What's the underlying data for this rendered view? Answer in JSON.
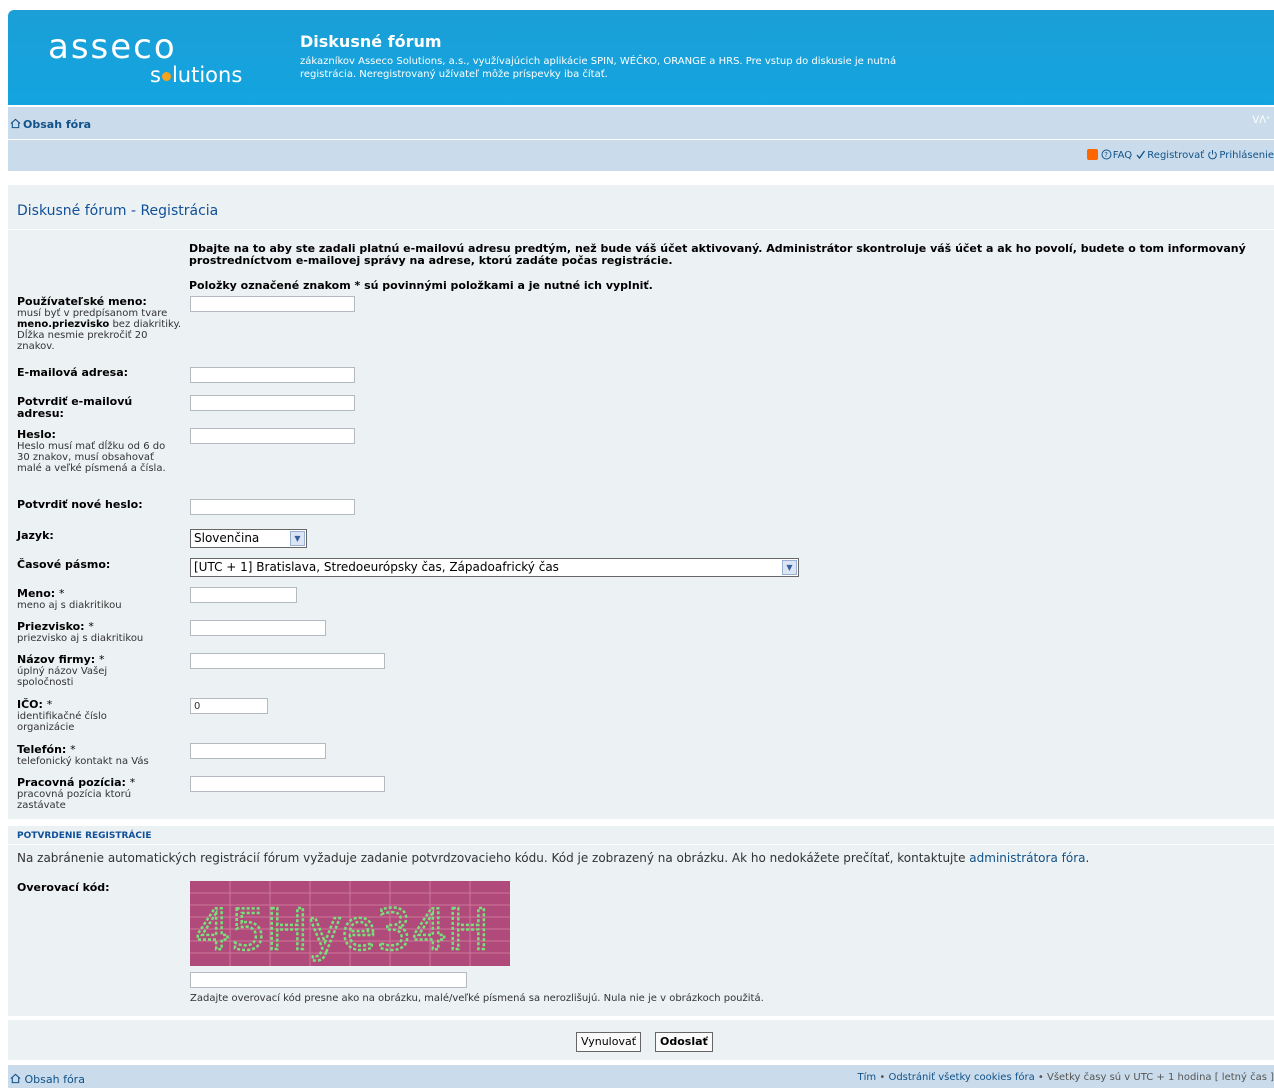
{
  "logo": {
    "big": "asseco",
    "small_before": "s",
    "small_after": "lutions"
  },
  "site": {
    "title": "Diskusné fórum",
    "desc": "zákazníkov Asseco Solutions, a.s., využívajúcich aplikácie SPIN, WÉČKO, ORANGE a HRS. Pre vstup do diskusie je nutná registrácia. Neregistrovaný užívateľ môže príspevky iba čítať."
  },
  "nav": {
    "crumb": "Obsah fóra",
    "resize": "ᐯᐱᐩ",
    "faq": "FAQ",
    "register": "Registrovať",
    "login": "Prihlásenie"
  },
  "page": {
    "heading": "Diskusné fórum - Registrácia",
    "intro": "Dbajte na to aby ste zadali platnú e-mailovú adresu predtým, než bude váš účet aktivovaný. Administrátor skontroluje váš účet a ak ho povolí, budete o tom informovaný prostredníctvom e-mailovej správy na adrese, ktorú zadáte počas registrácie.",
    "required_note": "Položky označené znakom * sú povinnými položkami a je nutné ich vyplniť."
  },
  "fields": {
    "username": {
      "label": "Používateľské meno:",
      "exp1": "musí byť v predpísanom tvare ",
      "exp_bold": "meno.priezvisko",
      "exp2": " bez diakritiky. Dĺžka nesmie prekročiť 20 znakov."
    },
    "email": {
      "label": "E-mailová adresa:"
    },
    "email_confirm": {
      "label": "Potvrdiť e-mailovú adresu:"
    },
    "password": {
      "label": "Heslo:",
      "exp": "Heslo musí mať dĺžku od 6 do 30 znakov, musí obsahovať malé a veľké písmená a čísla."
    },
    "password_confirm": {
      "label": "Potvrdiť nové heslo:"
    },
    "language": {
      "label": "Jazyk:",
      "value": "Slovenčina"
    },
    "timezone": {
      "label": "Časové pásmo:",
      "value": "[UTC + 1] Bratislava, Stredoeurópsky čas, Západoafrický čas"
    },
    "firstname": {
      "label": "Meno: ",
      "star": "*",
      "exp": "meno aj s diakritikou"
    },
    "lastname": {
      "label": "Priezvisko: ",
      "star": "*",
      "exp": "priezvisko aj s diakritikou"
    },
    "company": {
      "label": "Názov firmy: ",
      "star": "*",
      "exp": "úplný názov Vašej spoločnosti"
    },
    "ico": {
      "label": "IČO: ",
      "star": "*",
      "exp": "identifikačné číslo organizácie",
      "value": "0"
    },
    "phone": {
      "label": "Telefón: ",
      "star": "*",
      "exp": "telefonický kontakt na Vás"
    },
    "position": {
      "label": "Pracovná pozícia: ",
      "star": "*",
      "exp": "pracovná pozícia ktorú zastávate"
    }
  },
  "confirm": {
    "heading": "POTVRDENIE REGISTRÁCIE",
    "text": "Na zabránenie automatických registrácií fórum vyžaduje zadanie potvrdzovacieho kódu. Kód je zobrazený na obrázku. Ak ho nedokážete prečítať, kontaktujte ",
    "link": "administrátora fóra",
    "text_end": ".",
    "code_label": "Overovací kód:",
    "captcha_text": "45Hye34H",
    "hint": "Zadajte overovací kód presne ako na obrázku, malé/veľké písmená sa nerozlišujú. Nula nie je v obrázkoch použitá."
  },
  "buttons": {
    "reset": "Vynulovať",
    "submit": "Odoslať"
  },
  "footer": {
    "crumb": "Obsah fóra",
    "team": "Tím",
    "sep1": " • ",
    "cookies": "Odstrániť všetky cookies fóra",
    "times": " • Všetky časy sú v UTC + 1 hodina [ letný čas ]"
  },
  "colors": {
    "header": "#13a4e0",
    "nav": "#cadceb",
    "panel": "#ecf1f3",
    "link": "#105289",
    "captcha_bg": "#b04a7a"
  }
}
